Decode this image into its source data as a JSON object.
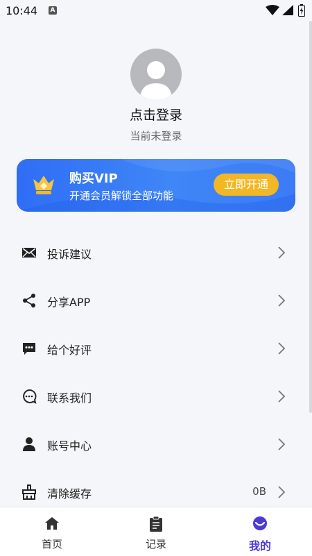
{
  "status_bar": {
    "time": "10:44",
    "notification_icon": "A"
  },
  "profile": {
    "title": "点击登录",
    "subtitle": "当前未登录"
  },
  "vip": {
    "title": "购买VIP",
    "subtitle": "开通会员解锁全部功能",
    "button": "立即开通"
  },
  "menu": [
    {
      "label": "投诉建议",
      "icon": "mail-icon"
    },
    {
      "label": "分享APP",
      "icon": "share-icon"
    },
    {
      "label": "给个好评",
      "icon": "review-icon"
    },
    {
      "label": "联系我们",
      "icon": "chat-icon"
    },
    {
      "label": "账号中心",
      "icon": "user-icon"
    },
    {
      "label": "清除缓存",
      "icon": "broom-icon",
      "value": "0B"
    }
  ],
  "nav": [
    {
      "label": "首页",
      "icon": "home-icon"
    },
    {
      "label": "记录",
      "icon": "clipboard-icon"
    },
    {
      "label": "我的",
      "icon": "profile-icon",
      "active": true
    }
  ],
  "colors": {
    "accent": "#4b39d8",
    "vip_blue": "#2f6ef5",
    "vip_button": "#f2b724",
    "background": "#f5f6fa"
  }
}
